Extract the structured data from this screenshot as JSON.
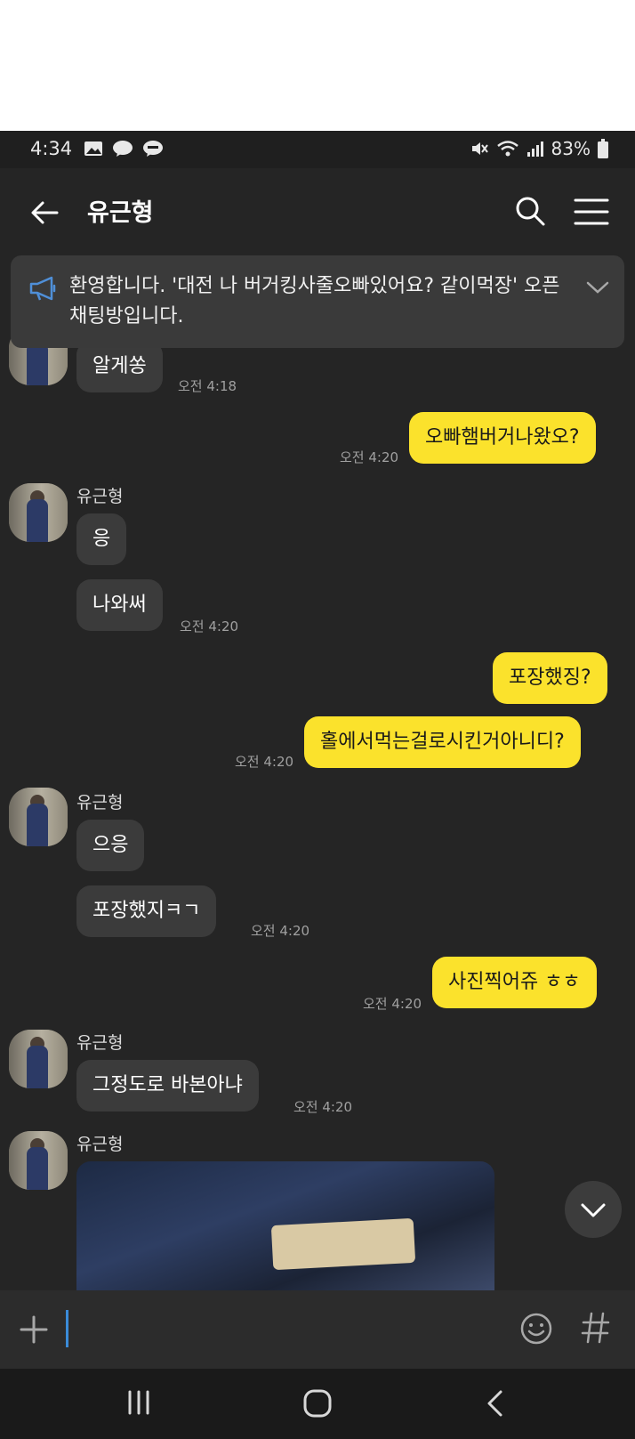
{
  "status_bar": {
    "time": "4:34",
    "battery": "83%"
  },
  "header": {
    "title": "유근형"
  },
  "notice": {
    "text": "환영합니다. '대전 나 버거킹사줄오빠있어요? 같이먹장' 오픈채팅방입니다."
  },
  "messages": {
    "m1": {
      "text": "알게쏭",
      "time": "오전 4:18"
    },
    "m2": {
      "text": "오빠햄버거나왔오?",
      "time": "오전 4:20"
    },
    "g1_sender": "유근형",
    "m3": {
      "text": "응"
    },
    "m4": {
      "text": "나와써",
      "time": "오전 4:20"
    },
    "m5": {
      "text": "포장했징?"
    },
    "m6": {
      "text": "홀에서먹는걸로시킨거아니디?",
      "time": "오전 4:20"
    },
    "g2_sender": "유근형",
    "m7": {
      "text": "으응"
    },
    "m8": {
      "text": "포장했지ㅋㄱ",
      "time": "오전 4:20"
    },
    "m9": {
      "text": "사진찍어쥬 ㅎㅎ",
      "time": "오전 4:20"
    },
    "g3_sender": "유근형",
    "m10": {
      "text": "그정도로 바본아냐",
      "time": "오전 4:20"
    },
    "g4_sender": "유근형"
  },
  "colors": {
    "background": "#252525",
    "incoming_bubble": "#3b3b3b",
    "outgoing_bubble": "#fbe22c",
    "cursor": "#3a8bd9"
  },
  "icons": [
    "back-arrow-icon",
    "search-icon",
    "menu-icon",
    "megaphone-icon",
    "chevron-down-icon",
    "plus-icon",
    "emoji-icon",
    "hashtag-icon",
    "recent-apps-icon",
    "home-icon",
    "back-nav-icon"
  ]
}
